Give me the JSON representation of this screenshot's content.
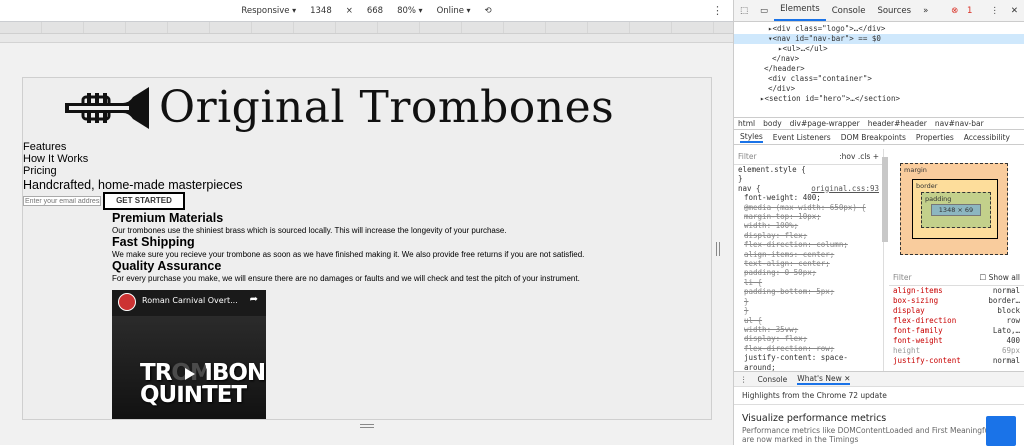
{
  "device_toolbar": {
    "mode": "Responsive",
    "width": "1348",
    "times": "×",
    "height": "668",
    "zoom": "80%",
    "network": "Online"
  },
  "site": {
    "title": "Original Trombones",
    "nav": [
      "Features",
      "How It Works",
      "Pricing"
    ],
    "hero_title": "Handcrafted, home-made masterpieces",
    "email_placeholder": "Enter your email address",
    "cta": "GET STARTED",
    "features": [
      {
        "title": "Premium Materials",
        "text": "Our trombones use the shiniest brass which is sourced locally. This will increase the longevity of your purchase."
      },
      {
        "title": "Fast Shipping",
        "text": "We make sure you recieve your trombone as soon as we have finished making it. We also provide free returns if you are not satisfied."
      },
      {
        "title": "Quality Assurance",
        "text": "For every purchase you make, we will ensure there are no damages or faults and we will check and test the pitch of your instrument."
      }
    ],
    "video": {
      "title": "Roman Carnival Overt...",
      "overlay": "TROMBONE QUINTET"
    }
  },
  "devtools": {
    "tabs": [
      "Elements",
      "Console",
      "Sources",
      "»"
    ],
    "error_count": "1",
    "dom": [
      "▸<div class=\"logo\">…</div>",
      "▾<nav id=\"nav-bar\"> == $0",
      "▸<ul>…</ul>",
      "</nav>",
      "</header>",
      "<div class=\"container\">",
      "</div>",
      "▸<section id=\"hero\">…</section>"
    ],
    "breadcrumbs": [
      "html",
      "body",
      "div#page-wrapper",
      "header#header",
      "nav#nav-bar"
    ],
    "style_tabs": [
      "Styles",
      "Event Listeners",
      "DOM Breakpoints",
      "Properties",
      "Accessibility"
    ],
    "filter_placeholder": "Filter",
    "filter_right": ":hov  .cls  +",
    "element_style": [
      "element.style {",
      "}"
    ],
    "rule_selector": "nav {",
    "rule_source": "original.css:93",
    "rule_props": [
      {
        "text": "font-weight: 400;",
        "strike": false
      },
      {
        "text": "@media (max-width: 650px) {",
        "strike": true
      },
      {
        "text": "margin-top: 10px;",
        "strike": true
      },
      {
        "text": "width: 100%;",
        "strike": true
      },
      {
        "text": "display: flex;",
        "strike": true
      },
      {
        "text": "flex-direction: column;",
        "strike": true
      },
      {
        "text": "align-items: center;",
        "strike": true
      },
      {
        "text": "text-align: center;",
        "strike": true
      },
      {
        "text": "padding: 0 50px;",
        "strike": true
      },
      {
        "text": "li {",
        "strike": true
      },
      {
        "text": "padding-bottom: 5px;",
        "strike": true
      },
      {
        "text": "}",
        "strike": true
      },
      {
        "text": "}",
        "strike": true
      },
      {
        "text": "ul {",
        "strike": true
      },
      {
        "text": "width: 35vw;",
        "strike": true
      },
      {
        "text": "display: flex;",
        "strike": true
      },
      {
        "text": "flex-direction: row;",
        "strike": true
      },
      {
        "text": "justify-content: space-",
        "strike": false
      },
      {
        "text": "around;",
        "strike": false
      }
    ],
    "box_model": {
      "margin": "margin",
      "border": "border",
      "padding": "padding",
      "content": "1348 × 69",
      "dash": "–"
    },
    "computed_filter": "Filter",
    "show_all": "Show all",
    "computed": [
      {
        "k": "align-items",
        "v": "normal",
        "gray": false
      },
      {
        "k": "box-sizing",
        "v": "border…",
        "gray": false
      },
      {
        "k": "display",
        "v": "block",
        "gray": false
      },
      {
        "k": "flex-direction",
        "v": "row",
        "gray": false
      },
      {
        "k": "font-family",
        "v": "Lato,…",
        "gray": false
      },
      {
        "k": "font-weight",
        "v": "400",
        "gray": false
      },
      {
        "k": "height",
        "v": "69px",
        "gray": true
      },
      {
        "k": "justify-content",
        "v": "normal",
        "gray": false
      }
    ],
    "drawer": {
      "tabs": [
        "Console",
        "What's New ✕"
      ],
      "highlight": "Highlights from the Chrome 72 update",
      "heading": "Visualize performance metrics",
      "body": "Performance metrics like DOMContentLoaded and First Meaningful Paint are now marked in the Timings"
    }
  }
}
